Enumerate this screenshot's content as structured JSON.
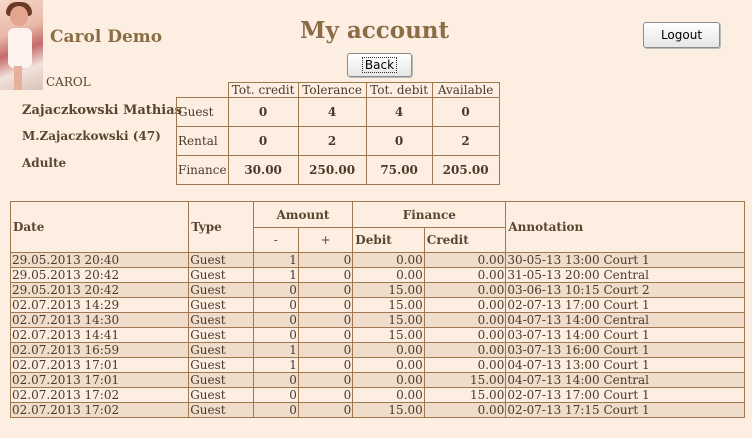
{
  "header": {
    "user_name": "Carol Demo",
    "username": "CAROL",
    "page_title": "My account",
    "logout_label": "Logout",
    "back_label": "Back"
  },
  "person": {
    "name": "Zajaczkowski Mathias",
    "child": "M.Zajaczkowski (47)",
    "category": "Adulte"
  },
  "summary": {
    "columns": [
      "Tot. credit",
      "Tolerance",
      "Tot. debit",
      "Available"
    ],
    "rows": [
      {
        "label": "Guest",
        "values": [
          "0",
          "4",
          "4",
          "0"
        ]
      },
      {
        "label": "Rental",
        "values": [
          "0",
          "2",
          "0",
          "2"
        ]
      },
      {
        "label": "Finance",
        "values": [
          "30.00",
          "250.00",
          "75.00",
          "205.00"
        ]
      }
    ]
  },
  "history": {
    "headers": {
      "date": "Date",
      "type": "Type",
      "amount": "Amount",
      "finance": "Finance",
      "annotation": "Annotation",
      "minus": "-",
      "plus": "+",
      "debit": "Debit",
      "credit": "Credit"
    },
    "rows": [
      {
        "date": "29.05.2013 20:40",
        "type": "Guest",
        "minus": "1",
        "plus": "0",
        "debit": "0.00",
        "credit": "0.00",
        "annotation": "30-05-13 13:00 Court 1"
      },
      {
        "date": "29.05.2013 20:42",
        "type": "Guest",
        "minus": "1",
        "plus": "0",
        "debit": "0.00",
        "credit": "0.00",
        "annotation": "31-05-13 20:00 Central"
      },
      {
        "date": "29.05.2013 20:42",
        "type": "Guest",
        "minus": "0",
        "plus": "0",
        "debit": "15.00",
        "credit": "0.00",
        "annotation": "03-06-13 10:15 Court 2"
      },
      {
        "date": "02.07.2013 14:29",
        "type": "Guest",
        "minus": "0",
        "plus": "0",
        "debit": "15.00",
        "credit": "0.00",
        "annotation": "02-07-13 17:00 Court 1"
      },
      {
        "date": "02.07.2013 14:30",
        "type": "Guest",
        "minus": "0",
        "plus": "0",
        "debit": "15.00",
        "credit": "0.00",
        "annotation": "04-07-13 14:00 Central"
      },
      {
        "date": "02.07.2013 14:41",
        "type": "Guest",
        "minus": "0",
        "plus": "0",
        "debit": "15.00",
        "credit": "0.00",
        "annotation": "03-07-13 14:00 Court 1"
      },
      {
        "date": "02.07.2013 16:59",
        "type": "Guest",
        "minus": "1",
        "plus": "0",
        "debit": "0.00",
        "credit": "0.00",
        "annotation": "03-07-13 16:00 Court 1"
      },
      {
        "date": "02.07.2013 17:01",
        "type": "Guest",
        "minus": "1",
        "plus": "0",
        "debit": "0.00",
        "credit": "0.00",
        "annotation": "04-07-13 13:00 Court 1"
      },
      {
        "date": "02.07.2013 17:01",
        "type": "Guest",
        "minus": "0",
        "plus": "0",
        "debit": "0.00",
        "credit": "15.00",
        "annotation": "04-07-13 14:00 Central"
      },
      {
        "date": "02.07.2013 17:02",
        "type": "Guest",
        "minus": "0",
        "plus": "0",
        "debit": "0.00",
        "credit": "15.00",
        "annotation": "02-07-13 17:00 Court 1"
      },
      {
        "date": "02.07.2013 17:02",
        "type": "Guest",
        "minus": "0",
        "plus": "0",
        "debit": "15.00",
        "credit": "0.00",
        "annotation": "02-07-13 17:15 Court 1"
      }
    ]
  }
}
